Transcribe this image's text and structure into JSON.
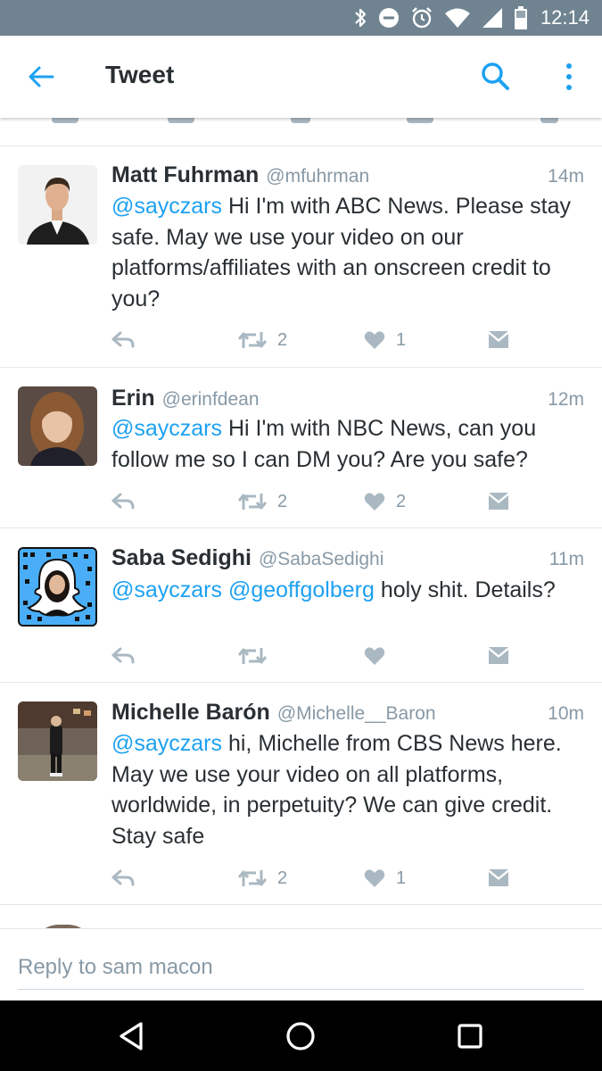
{
  "status_bar": {
    "time": "12:14",
    "icons": [
      "bluetooth-icon",
      "do-not-disturb-icon",
      "alarm-icon",
      "wifi-icon",
      "cell-signal-icon",
      "battery-icon"
    ]
  },
  "app_bar": {
    "title": "Tweet",
    "accent_color": "#1da1f2"
  },
  "tweets": [
    {
      "name": "Matt Fuhrman",
      "handle": "@mfuhrman",
      "time": "14m",
      "mentions": "@sayczars",
      "text": "Hi I'm with ABC News. Please stay safe. May we use your video on our platforms/affiliates with an onscreen credit to you?",
      "retweets": "2",
      "likes": "1"
    },
    {
      "name": "Erin",
      "handle": "@erinfdean",
      "time": "12m",
      "mentions": "@sayczars",
      "text": "Hi I'm with NBC News, can you follow me so I can DM you? Are you safe?",
      "retweets": "2",
      "likes": "2"
    },
    {
      "name": "Saba Sedighi",
      "handle": "@SabaSedighi",
      "time": "11m",
      "mentions": "@sayczars @geoffgolberg",
      "text": "holy shit. Details?",
      "retweets": "",
      "likes": ""
    },
    {
      "name": "Michelle Barón",
      "handle": "@Michelle__Baron",
      "time": "10m",
      "mentions": "@sayczars",
      "text": "hi, Michelle from CBS News here. May we use your video on all platforms, worldwide, in perpetuity? We can give credit. Stay safe",
      "retweets": "2",
      "likes": "1"
    }
  ],
  "reply": {
    "placeholder": "Reply to sam macon",
    "value": ""
  },
  "colors": {
    "status_bar_bg": "#6f8390",
    "mention": "#1da1f2",
    "secondary_text": "#8899a6",
    "action_icon": "#aab8c2",
    "nav_bar_bg": "#000000"
  }
}
